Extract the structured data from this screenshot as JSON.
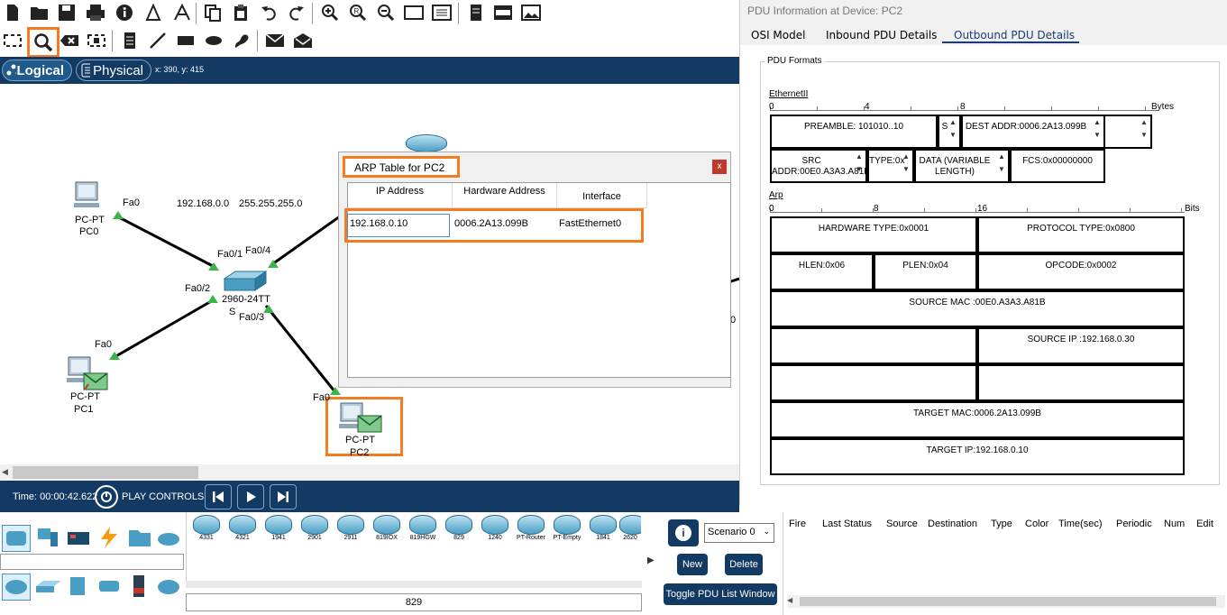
{
  "toolbar": {
    "items": [
      "new-icon",
      "open-icon",
      "save-icon",
      "print-icon",
      "info-icon",
      "network-wizard-icon",
      "copy-icon",
      "paste-icon",
      "undo-icon",
      "redo-icon",
      "zoom-in-icon",
      "zoom-reset-icon",
      "zoom-out-icon",
      "drawing-palette-icon",
      "custom-devices-icon",
      "viewport-icon",
      "cluster-icon",
      "image-icon"
    ],
    "row2": [
      "select-icon",
      "inspect-icon",
      "delete-icon",
      "resize-icon",
      "note-icon",
      "line-icon",
      "rectangle-icon",
      "ellipse-icon",
      "freeform-icon",
      "simple-pdu-icon",
      "complex-pdu-icon"
    ]
  },
  "workspace": {
    "logical_label": "Logical",
    "physical_label": "Physical",
    "coords": "x: 390, y: 415"
  },
  "topology": {
    "pc0_type": "PC-PT",
    "pc0_name": "PC0",
    "pc0_port": "Fa0",
    "pc1_type": "PC-PT",
    "pc1_name": "PC1",
    "pc1_port": "Fa0",
    "pc2_type": "PC-PT",
    "pc2_name": "PC2",
    "pc2_port": "Fa0",
    "network_addr": "192.168.0.0",
    "mask": "255.255.255.0",
    "switch_model": "2960-24TT",
    "switch_name": "S",
    "sw_fa01": "Fa0/1",
    "sw_fa02": "Fa0/2",
    "sw_fa03": "Fa0/3",
    "sw_fa04": "Fa0/4",
    "right_label": "0"
  },
  "arp": {
    "title": "ARP Table for PC2",
    "close": "x",
    "headers": [
      "IP Address",
      "Hardware Address",
      "Interface"
    ],
    "row": {
      "ip": "192.168.0.10",
      "mac": "0006.2A13.099B",
      "iface": "FastEthernet0"
    }
  },
  "timebar": {
    "time": "Time: 00:00:42.622",
    "play_controls": "PLAY CONTROLS:"
  },
  "devices": {
    "models": [
      "4331",
      "4321",
      "1941",
      "2901",
      "2911",
      "819IOX",
      "819HGW",
      "829",
      "1240",
      "PT-Router",
      "PT-Empty",
      "1841",
      "2620"
    ],
    "selected_model": "829"
  },
  "scenario": {
    "info_glyph": "i",
    "select": "Scenario 0",
    "new": "New",
    "delete": "Delete",
    "toggle": "Toggle PDU List Window"
  },
  "eventlist": {
    "headers": [
      "Fire",
      "Last Status",
      "Source",
      "Destination",
      "Type",
      "Color",
      "Time(sec)",
      "Periodic",
      "Num",
      "Edit"
    ]
  },
  "pdu": {
    "title": "PDU Information at Device: PC2",
    "tabs": [
      "OSI Model",
      "Inbound PDU Details",
      "Outbound PDU Details"
    ],
    "formats_label": "PDU Formats",
    "ethernet": {
      "label": "EthernetII",
      "ruler": [
        "0",
        "4",
        "8"
      ],
      "unit": "Bytes",
      "preamble": "PREAMBLE: 101010..10",
      "sfd": "S",
      "dest": "DEST ADDR:0006.2A13.099B",
      "src": "SRC ADDR:00E0.A3A3.A81B",
      "type": "TYPE:0x",
      "data": "DATA (VARIABLE LENGTH)",
      "fcs": "FCS:0x00000000"
    },
    "arp": {
      "label": "Arp",
      "ruler": [
        "0",
        "8",
        "16"
      ],
      "unit": "Bits",
      "hw_type": "HARDWARE TYPE:0x0001",
      "proto_type": "PROTOCOL TYPE:0x0800",
      "hlen": "HLEN:0x06",
      "plen": "PLEN:0x04",
      "opcode": "OPCODE:0x0002",
      "source_mac": "SOURCE MAC :00E0.A3A3.A81B",
      "source_ip": "SOURCE IP :192.168.0.30",
      "target_mac": "TARGET MAC:0006.2A13.099B",
      "target_ip": "TARGET IP:192.168.0.10"
    }
  },
  "colors": {
    "accent_orange": "#f47b20",
    "navy": "#123a63",
    "link_green": "#3bb54a"
  }
}
